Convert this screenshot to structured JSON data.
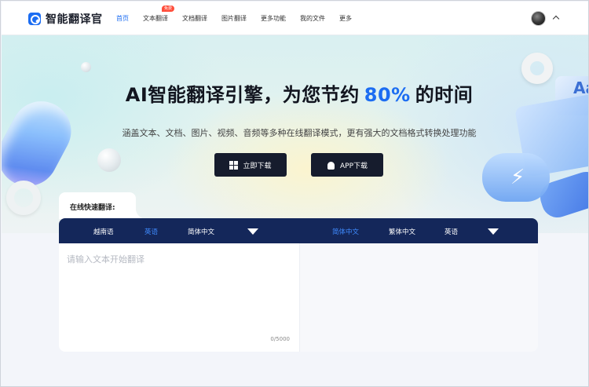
{
  "header": {
    "logo_text": "智能翻译官",
    "nav": [
      {
        "label": "首页",
        "active": true
      },
      {
        "label": "文本翻译",
        "badge": "免费"
      },
      {
        "label": "文档翻译"
      },
      {
        "label": "图片翻译"
      },
      {
        "label": "更多功能"
      },
      {
        "label": "我的文件"
      },
      {
        "label": "更多"
      }
    ]
  },
  "hero": {
    "title_before": "AI智能翻译引擎，为您节约",
    "title_highlight": "80%",
    "title_after": "的时间",
    "subtitle": "涵盖文本、文档、图片、视频、音频等多种在线翻译模式，更有强大的文档格式转换处理功能",
    "download_button": "立即下载",
    "app_button": "APP下载",
    "deco_card_text": "Aa"
  },
  "translator": {
    "quick_label": "在线快速翻译:",
    "source_langs": [
      "越南语",
      "英语",
      "简体中文"
    ],
    "source_active": "英语",
    "target_langs": [
      "简体中文",
      "繁体中文",
      "英语"
    ],
    "target_active": "简体中文",
    "placeholder": "请输入文本开始翻译",
    "counter": "0/5000"
  },
  "colors": {
    "accent": "#1c6df2",
    "lang_bar": "#14275a",
    "button_dark": "#161c2d",
    "badge": "#ff4d3a"
  }
}
